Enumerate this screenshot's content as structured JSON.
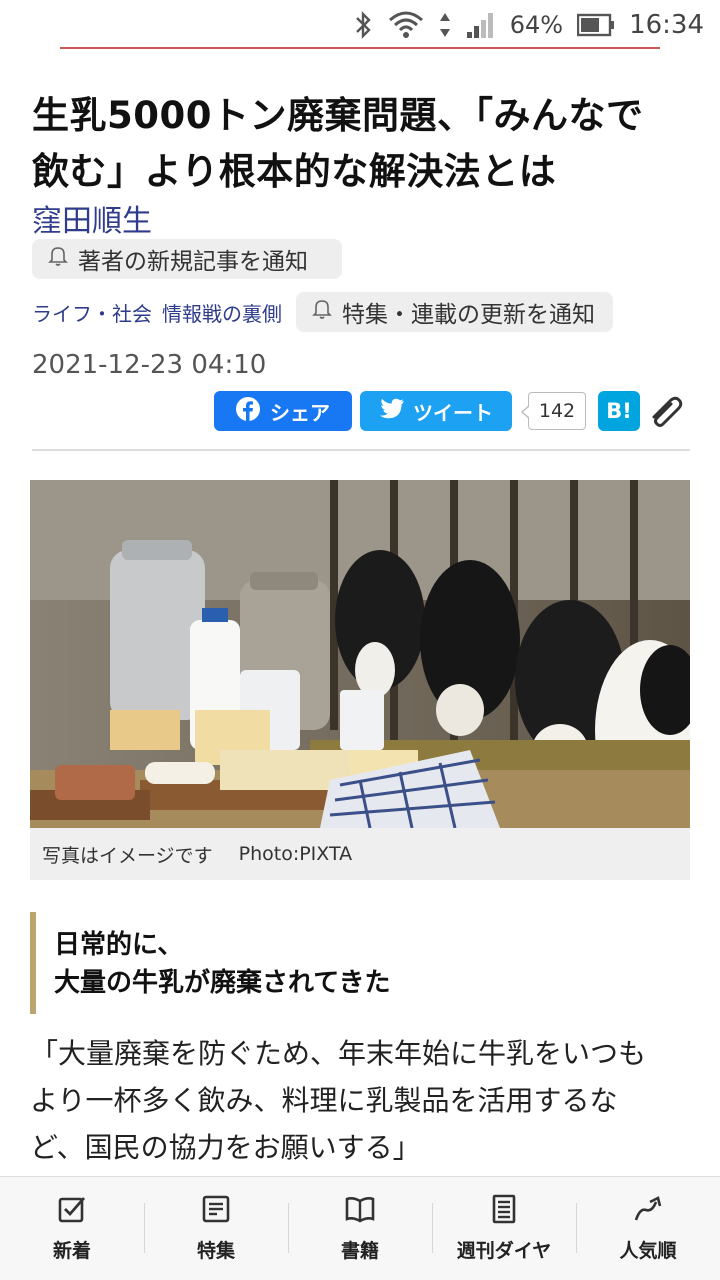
{
  "status_bar": {
    "battery_percent": "64%",
    "time": "16:34",
    "icons": [
      "bluetooth-icon",
      "wifi-icon",
      "signal-icon",
      "battery-icon"
    ]
  },
  "article": {
    "title_line1": "生乳5000トン廃棄問題、「みんなで",
    "title_line2": "飲む」より根本的な解決法とは",
    "author": "窪田順生",
    "notify_author_label": "著者の新規記事を通知",
    "category_1": "ライフ・社会",
    "category_2": "情報戦の裏側",
    "notify_series_label": "特集・連載の更新を通知",
    "date": "2021-12-23 04:10"
  },
  "share": {
    "facebook_label": "シェア",
    "twitter_label": "ツイート",
    "tweet_count": "142",
    "hatena_label": "B!"
  },
  "photo": {
    "caption": "写真はイメージです",
    "credit": "Photo:PIXTA"
  },
  "section": {
    "heading_line1": "日常的に、",
    "heading_line2": "大量の牛乳が廃棄されてきた",
    "body_line1": "「大量廃棄を防ぐため、年末年始に牛乳をいつも",
    "body_line2": "より一杯多く飲み、料理に乳製品を活用するな",
    "body_line3": "ど、国民の協力をお願いする」"
  },
  "bottom_nav": {
    "items": [
      {
        "label": "新着",
        "icon": "checkbox-icon"
      },
      {
        "label": "特集",
        "icon": "document-list-icon"
      },
      {
        "label": "書籍",
        "icon": "open-book-icon"
      },
      {
        "label": "週刊ダイヤ",
        "icon": "magazine-icon"
      },
      {
        "label": "人気順",
        "icon": "trending-arrow-icon"
      }
    ]
  },
  "colors": {
    "author_link": "#2f3c8c",
    "facebook": "#1877f2",
    "twitter": "#1da1f2",
    "hatena": "#00a4de",
    "heading_accent": "#b9a56f",
    "top_rule": "#c85a5a"
  }
}
